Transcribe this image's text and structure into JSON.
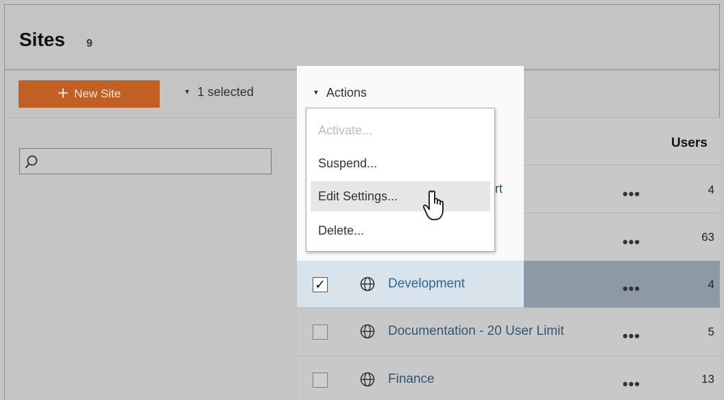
{
  "page": {
    "title": "Sites",
    "count": "9"
  },
  "toolbar": {
    "new_site_label": "New Site",
    "selected_label": "1 selected",
    "actions_label": "Actions"
  },
  "search": {
    "value": "",
    "placeholder": ""
  },
  "table": {
    "users_header": "Users"
  },
  "menu": {
    "items": [
      {
        "label": "Activate...",
        "disabled": true
      },
      {
        "label": "Suspend...",
        "disabled": false
      },
      {
        "label": "Edit Settings...",
        "disabled": false,
        "hovered": true
      },
      {
        "label": "Delete...",
        "disabled": false
      }
    ]
  },
  "rows": [
    {
      "name_fragment": "ort",
      "more": "•••",
      "users": "4",
      "checked": false
    },
    {
      "name_fragment": "",
      "more": "•••",
      "users": "63",
      "checked": false
    },
    {
      "name": "Development",
      "more": "•••",
      "users": "4",
      "checked": true
    },
    {
      "name": "Documentation - 20 User Limit",
      "more": "•••",
      "users": "5",
      "checked": false
    },
    {
      "name": "Finance",
      "more": "•••",
      "users": "13",
      "checked": false
    }
  ],
  "checkmark": "✓",
  "colors": {
    "new_site_button": "#c25f25",
    "link": "#2f5874",
    "selected_row": "#d8e3ec"
  }
}
